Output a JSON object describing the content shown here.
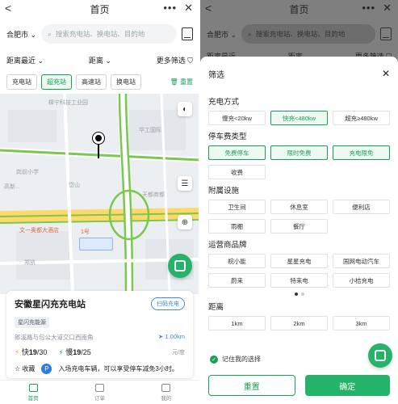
{
  "header": {
    "title": "首页",
    "more": "•••",
    "close": "✕",
    "back": "<"
  },
  "search": {
    "city": "合肥市",
    "placeholder": "搜索充电站、换电站、目的地"
  },
  "filters": {
    "sort": "距离最近",
    "distance": "距离",
    "more": "更多筛选"
  },
  "chips": [
    "充电站",
    "超充站",
    "高速站",
    "换电站"
  ],
  "reset_link": "重置",
  "map": {
    "labels": [
      "樟宁科技工业园",
      "华工国际",
      "岗前小学",
      "高新...",
      "天都商都",
      "岱山",
      "文一奥都大酒店",
      "1号",
      "郑凯"
    ]
  },
  "station": {
    "name": "安徽星闪充充电站",
    "nav_button": "扫码充电",
    "tag": "星闪充能源",
    "address": "郎溪路与包公大道交口西南角",
    "distance": "1.00km",
    "fast_label": "快",
    "fast_count": "19",
    "fast_total": "/30",
    "slow_label": "慢",
    "slow_count": "19",
    "slow_total": "/25",
    "unit": "元/度",
    "favorite": "收藏",
    "parking_notice": "入场充电车辆，可以享受停车减免3小时。"
  },
  "bottom_nav": [
    "首页",
    "订单",
    "我的"
  ],
  "sheet": {
    "title": "筛选",
    "sections": [
      {
        "name": "充电方式",
        "options": [
          "慢充<20kw",
          "快充<480kw",
          "超充≥480kw"
        ],
        "selected": [
          1
        ]
      },
      {
        "name": "停车费类型",
        "options": [
          "免费停车",
          "限时免费",
          "充电限免",
          "收费"
        ],
        "selected": [
          0,
          1,
          2
        ]
      },
      {
        "name": "附属设施",
        "options": [
          "卫生间",
          "休息室",
          "便利店",
          "雨棚",
          "餐厅"
        ],
        "selected": []
      },
      {
        "name": "运营商品牌",
        "options": [
          "皖小能",
          "星星充电",
          "国网电动汽车",
          "蔚来",
          "特来电",
          "小桔充电"
        ],
        "selected": []
      },
      {
        "name": "距离",
        "options": [
          "1km",
          "2km",
          "3km"
        ],
        "selected": []
      }
    ],
    "remember": "记住我的选择",
    "reset": "重置",
    "confirm": "确定"
  },
  "colors": {
    "accent": "#18a057",
    "scan": "#25b36a",
    "link": "#3b8ae6"
  }
}
